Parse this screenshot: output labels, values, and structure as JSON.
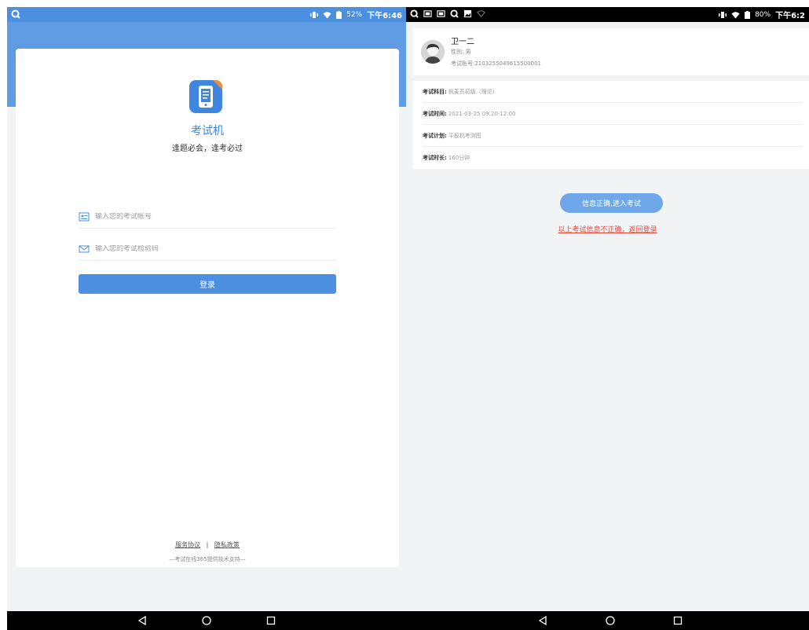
{
  "left_screen": {
    "status_bar": {
      "battery": "52%",
      "time": "下午6:46"
    },
    "app": {
      "title": "考试机",
      "slogan": "逢题必会，逢考必过"
    },
    "form": {
      "account_placeholder": "输入您的考试帐号",
      "code_placeholder": "输入您的考试检验码",
      "login_label": "登录"
    },
    "footer": {
      "service_agreement": "服务协议",
      "separator": "|",
      "privacy_policy": "隐私政策",
      "support_note": "—考试在线365提供技术支持—"
    }
  },
  "right_screen": {
    "status_bar": {
      "battery": "80%",
      "time": "下午6:2"
    },
    "profile": {
      "name": "卫一二",
      "gender": "性别: 男",
      "account": "考试账号:2103255049615500001"
    },
    "exam_info": [
      {
        "key": "考试科目:",
        "value": "帆麦员初级（理论）"
      },
      {
        "key": "考试时间:",
        "value": "2021-03-25 09:20-12:00"
      },
      {
        "key": "考试计划:",
        "value": "平板机考测图"
      },
      {
        "key": "考试时长:",
        "value": "160分钟"
      }
    ],
    "enter_button": "信息正确,进入考试",
    "back_link": "以上考试信息不正确，返回登录"
  },
  "colors": {
    "primary_blue": "#4a8fe0",
    "link_red": "#e24a3a"
  },
  "icons": [
    "search-icon",
    "account-card-icon",
    "mail-icon",
    "back-icon",
    "home-icon",
    "recents-icon",
    "wifi-icon",
    "battery-icon",
    "avatar"
  ]
}
